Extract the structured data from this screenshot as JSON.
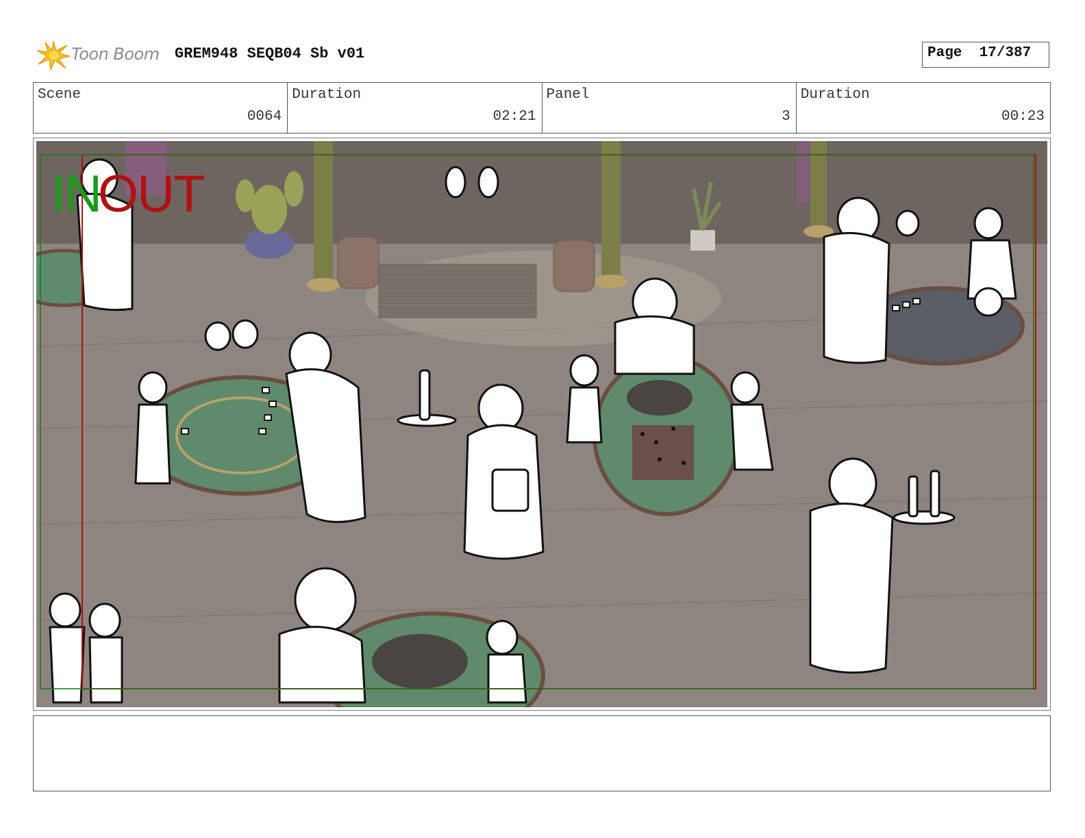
{
  "header": {
    "logo_text": "Toon Boom",
    "doc_title": "GREM948 SEQB04 Sb v01",
    "page_label": "Page",
    "page_value": "17/387"
  },
  "info": [
    {
      "label": "Scene",
      "value": "0064"
    },
    {
      "label": "Duration",
      "value": "02:21"
    },
    {
      "label": "Panel",
      "value": "3"
    },
    {
      "label": "Duration",
      "value": "00:23"
    }
  ],
  "panel": {
    "in_label": "IN",
    "out_label": "OUT"
  },
  "notes": {
    "text": ""
  },
  "colors": {
    "in_marker": "#1a9a1a",
    "out_marker": "#b01010",
    "scene_bg": "#8f8580",
    "table_felt": "#5f8a6c"
  }
}
